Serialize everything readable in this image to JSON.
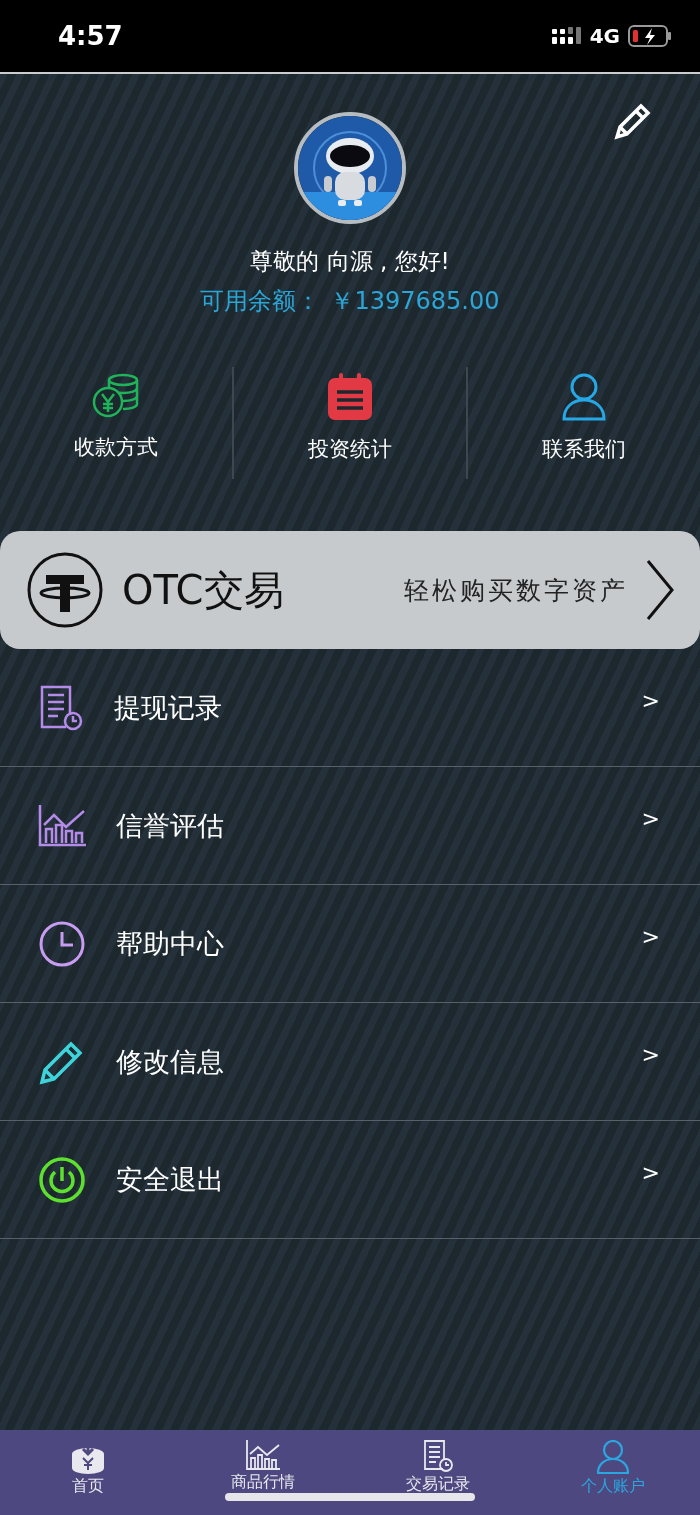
{
  "status_bar": {
    "time": "4:57",
    "network": "4G"
  },
  "profile": {
    "greeting": "尊敬的 向源 , 您好!",
    "balance_label": "可用余额：",
    "balance": "￥1397685.00"
  },
  "quick_actions": [
    {
      "label": "收款方式",
      "kind": "payment"
    },
    {
      "label": "投资统计",
      "kind": "stats"
    },
    {
      "label": "联系我们",
      "kind": "contact"
    }
  ],
  "banner": {
    "title": "OTC交易",
    "subtitle": "轻松购买数字资产"
  },
  "menu": [
    {
      "label": "提现记录",
      "kind": "record",
      "arrow": ">"
    },
    {
      "label": "信誉评估",
      "kind": "chart",
      "arrow": ">"
    },
    {
      "label": "帮助中心",
      "kind": "clock",
      "arrow": ">"
    },
    {
      "label": "修改信息",
      "kind": "edit",
      "arrow": ">"
    },
    {
      "label": "安全退出",
      "kind": "power",
      "arrow": ">"
    }
  ],
  "tab_bar": [
    {
      "label": "首页",
      "kind": "home",
      "selected": false
    },
    {
      "label": "商品行情",
      "kind": "chart",
      "selected": false
    },
    {
      "label": "交易记录",
      "kind": "record",
      "selected": false
    },
    {
      "label": "个人账户",
      "kind": "user",
      "selected": true
    }
  ]
}
